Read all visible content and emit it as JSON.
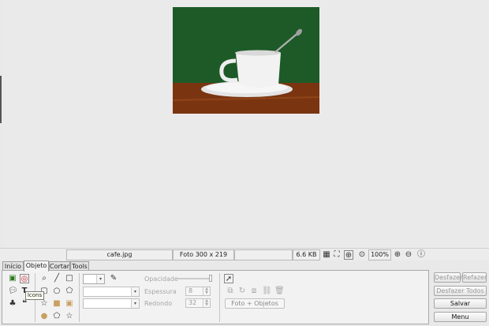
{
  "image": {
    "filename": "cafe.jpg",
    "info": "Foto 300 x 219",
    "size": "6.6 KB",
    "zoom": "100%"
  },
  "tabs": [
    {
      "label": "Início",
      "active": false
    },
    {
      "label": "Objeto",
      "active": true
    },
    {
      "label": "Cortar",
      "active": false
    },
    {
      "label": "Tools",
      "active": false
    }
  ],
  "panel": {
    "opacity_label": "Opacidade",
    "thickness_label": "Espessura",
    "thickness_value": "8",
    "round_label": "Redondo",
    "round_value": "32",
    "photo_objects_label": "Foto + Objetos",
    "tooltip": "Icons"
  },
  "actions": {
    "undo": "Desfazer",
    "redo": "Refazer",
    "undo_all": "Desfazer Todos",
    "save": "Salvar",
    "menu": "Menu"
  },
  "colors": {
    "panel_bg": "#f2f2f2",
    "canvas_bg": "#eaeaea"
  }
}
